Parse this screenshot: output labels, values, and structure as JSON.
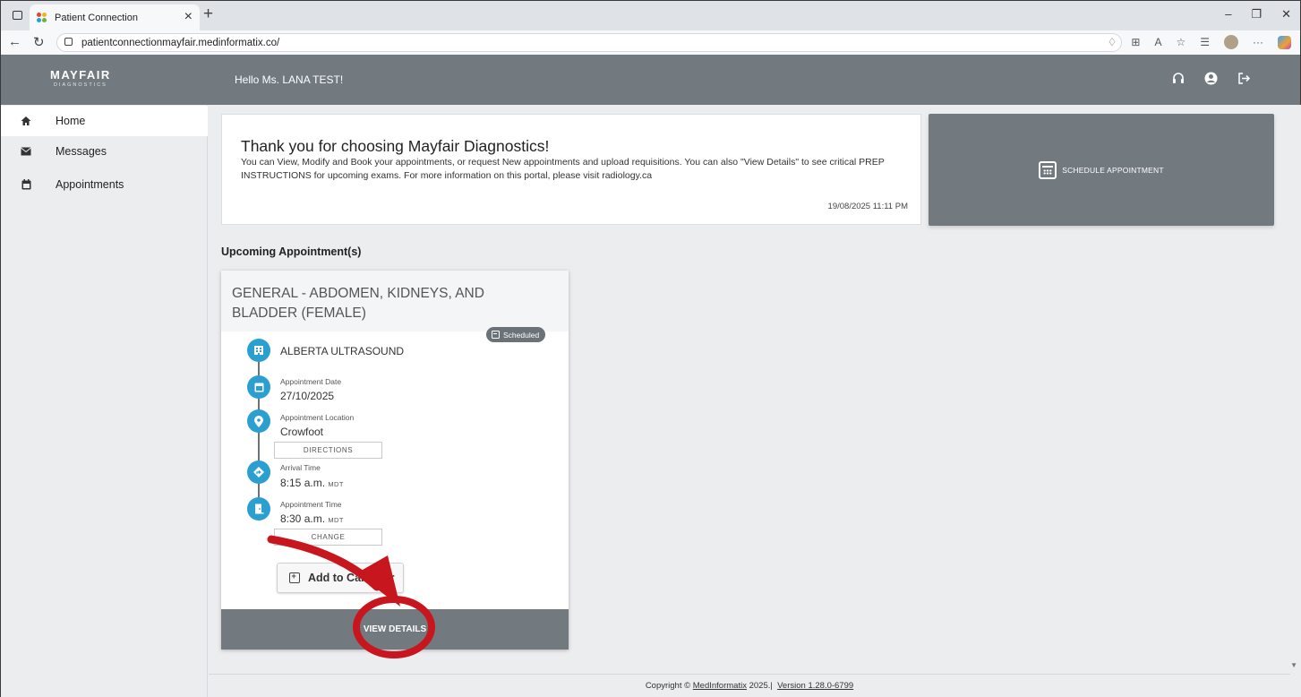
{
  "browser": {
    "tab_title": "Patient Connection",
    "url": "patientconnectionmayfair.medinformatix.co/"
  },
  "header": {
    "logo_main": "MAYFAIR",
    "logo_sub": "DIAGNOSTICS",
    "greeting": "Hello Ms. LANA TEST!"
  },
  "sidebar": {
    "items": [
      {
        "label": "Home",
        "icon": "home-icon",
        "active": true
      },
      {
        "label": "Messages",
        "icon": "envelope-icon",
        "active": false
      },
      {
        "label": "Appointments",
        "icon": "calendar-icon",
        "active": false
      }
    ]
  },
  "welcome": {
    "title": "Thank you for choosing Mayfair Diagnostics!",
    "body": "You can View, Modify and Book your appointments, or request New appointments and upload requisitions. You can also \"View Details\" to see critical PREP INSTRUCTIONS for upcoming exams. For more information on this portal, please visit radiology.ca",
    "datetime": "19/08/2025 11:11 PM"
  },
  "schedule_button": {
    "label": "SCHEDULE APPOINTMENT"
  },
  "upcoming": {
    "section_title": "Upcoming Appointment(s)",
    "appointment": {
      "title": "GENERAL - ABDOMEN, KIDNEYS, AND BLADDER (FEMALE)",
      "status": "Scheduled",
      "facility": "ALBERTA ULTRASOUND",
      "date_label": "Appointment Date",
      "date": "27/10/2025",
      "location_label": "Appointment Location",
      "location": "Crowfoot",
      "directions_label": "DIRECTIONS",
      "arrival_label": "Arrival Time",
      "arrival_time": "8:15 a.m.",
      "arrival_tz": "MDT",
      "appt_time_label": "Appointment Time",
      "appt_time": "8:30 a.m.",
      "appt_tz": "MDT",
      "change_label": "CHANGE",
      "add_calendar_label": "Add to Calendar",
      "view_details_label": "VIEW DETAILS"
    }
  },
  "footer": {
    "copyright_prefix": "Copyright ©",
    "company": "MedInformatix",
    "year_suffix": "2025.|",
    "version": "Version 1.28.0-6799"
  },
  "colors": {
    "header_gray": "#727a80",
    "accent_blue": "#2a9fd0",
    "annotation_red": "#c8161e"
  }
}
